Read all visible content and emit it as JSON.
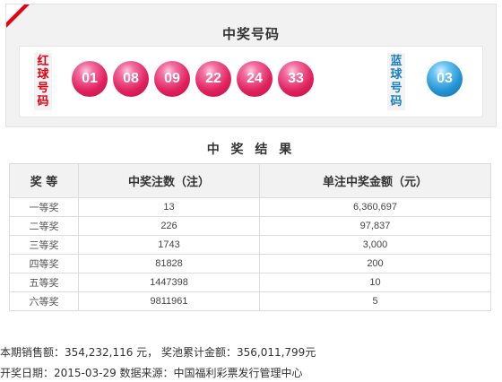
{
  "draw": {
    "title": "中奖号码",
    "red_label": [
      "红",
      "球",
      "号",
      "码"
    ],
    "blue_label": [
      "蓝",
      "球",
      "号",
      "码"
    ],
    "red_balls": [
      "01",
      "08",
      "09",
      "22",
      "24",
      "33"
    ],
    "blue_ball": "03"
  },
  "results": {
    "title": "中 奖 结 果",
    "headers": [
      "奖 等",
      "中奖注数（注）",
      "单注中奖金额（元）"
    ],
    "rows": [
      {
        "level": "一等奖",
        "count": "13",
        "amount": "6,360,697"
      },
      {
        "level": "二等奖",
        "count": "226",
        "amount": "97,837"
      },
      {
        "level": "三等奖",
        "count": "1743",
        "amount": "3,000"
      },
      {
        "level": "四等奖",
        "count": "81828",
        "amount": "200"
      },
      {
        "level": "五等奖",
        "count": "1447398",
        "amount": "10"
      },
      {
        "level": "六等奖",
        "count": "9811961",
        "amount": "5"
      }
    ]
  },
  "footer": {
    "line1": "本期销售额：354,232,116 元， 奖池累计金额：356,011,799元",
    "line2": "开奖日期：2015-03-29 数据来源：中国福利彩票发行管理中心"
  },
  "colors": {
    "red": "#e60012",
    "blue": "#1a7fc4"
  }
}
